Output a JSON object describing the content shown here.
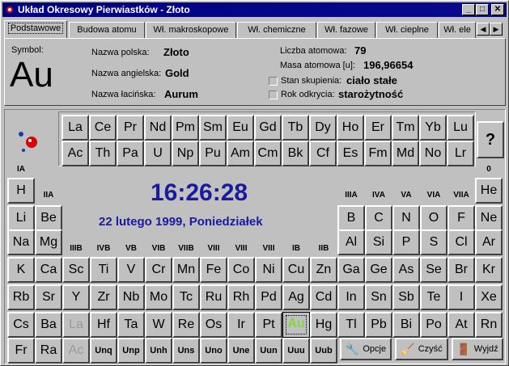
{
  "window": {
    "title": "Układ Okresowy Pierwiastków - Złoto",
    "controls": [
      "minimize",
      "maximize",
      "close"
    ]
  },
  "tabs": [
    {
      "label": "Podstawowe",
      "active": true
    },
    {
      "label": "Budowa atomu"
    },
    {
      "label": "Wł. makroskopowe"
    },
    {
      "label": "Wł. chemiczne"
    },
    {
      "label": "Wł. fazowe"
    },
    {
      "label": "Wł. cieplne"
    },
    {
      "label": "Wł. ele"
    }
  ],
  "info": {
    "symbol_label": "Symbol:",
    "symbol": "Au",
    "polish_label": "Nazwa polska:",
    "polish": "Złoto",
    "english_label": "Nazwa angielska:",
    "english": "Gold",
    "latin_label": "Nazwa łacińska:",
    "latin": "Aurum",
    "atomic_number_label": "Liczba atomowa:",
    "atomic_number": "79",
    "atomic_mass_label": "Masa atomowa [u]:",
    "atomic_mass": "196,96654",
    "state_label": "Stan skupienia:",
    "state": "ciało stałe",
    "discovery_label": "Rok odkrycia:",
    "discovery": "starożytność"
  },
  "clock": {
    "time": "16:26:28",
    "date": "22 lutego 1999, Poniedziałek"
  },
  "help_label": "?",
  "buttons": {
    "options": "Opcje",
    "clear": "Czyść",
    "exit": "Wyjdź"
  },
  "groups": {
    "IA": "IA",
    "IIA": "IIA",
    "IIIB": "IIIB",
    "IVB": "IVB",
    "VB": "VB",
    "VIB": "VIB",
    "VIIB": "VIIB",
    "VIII1": "VIII",
    "VIII2": "VIII",
    "VIII3": "VIII",
    "IB": "IB",
    "IIB": "IIB",
    "IIIA": "IIIA",
    "IVA": "IVA",
    "VA": "VA",
    "VIA": "VIA",
    "VIIA": "VIIA",
    "zero": "0"
  },
  "lanthanides": [
    "La",
    "Ce",
    "Pr",
    "Nd",
    "Pm",
    "Sm",
    "Eu",
    "Gd",
    "Tb",
    "Dy",
    "Ho",
    "Er",
    "Tm",
    "Yb",
    "Lu"
  ],
  "actinides": [
    "Ac",
    "Th",
    "Pa",
    "U",
    "Np",
    "Pu",
    "Am",
    "Cm",
    "Bk",
    "Cf",
    "Es",
    "Fm",
    "Md",
    "No",
    "Lr"
  ],
  "elements": [
    {
      "s": "H",
      "r": 0,
      "c": 0
    },
    {
      "s": "He",
      "r": 0,
      "c": 17
    },
    {
      "s": "Li",
      "r": 1,
      "c": 0
    },
    {
      "s": "Be",
      "r": 1,
      "c": 1
    },
    {
      "s": "B",
      "r": 1,
      "c": 12
    },
    {
      "s": "C",
      "r": 1,
      "c": 13
    },
    {
      "s": "N",
      "r": 1,
      "c": 14
    },
    {
      "s": "O",
      "r": 1,
      "c": 15
    },
    {
      "s": "F",
      "r": 1,
      "c": 16
    },
    {
      "s": "Ne",
      "r": 1,
      "c": 17
    },
    {
      "s": "Na",
      "r": 2,
      "c": 0
    },
    {
      "s": "Mg",
      "r": 2,
      "c": 1
    },
    {
      "s": "Al",
      "r": 2,
      "c": 12
    },
    {
      "s": "Si",
      "r": 2,
      "c": 13
    },
    {
      "s": "P",
      "r": 2,
      "c": 14
    },
    {
      "s": "S",
      "r": 2,
      "c": 15
    },
    {
      "s": "Cl",
      "r": 2,
      "c": 16
    },
    {
      "s": "Ar",
      "r": 2,
      "c": 17
    },
    {
      "s": "K",
      "r": 3,
      "c": 0
    },
    {
      "s": "Ca",
      "r": 3,
      "c": 1
    },
    {
      "s": "Sc",
      "r": 3,
      "c": 2
    },
    {
      "s": "Ti",
      "r": 3,
      "c": 3
    },
    {
      "s": "V",
      "r": 3,
      "c": 4
    },
    {
      "s": "Cr",
      "r": 3,
      "c": 5
    },
    {
      "s": "Mn",
      "r": 3,
      "c": 6
    },
    {
      "s": "Fe",
      "r": 3,
      "c": 7
    },
    {
      "s": "Co",
      "r": 3,
      "c": 8
    },
    {
      "s": "Ni",
      "r": 3,
      "c": 9
    },
    {
      "s": "Cu",
      "r": 3,
      "c": 10
    },
    {
      "s": "Zn",
      "r": 3,
      "c": 11
    },
    {
      "s": "Ga",
      "r": 3,
      "c": 12
    },
    {
      "s": "Ge",
      "r": 3,
      "c": 13
    },
    {
      "s": "As",
      "r": 3,
      "c": 14
    },
    {
      "s": "Se",
      "r": 3,
      "c": 15
    },
    {
      "s": "Br",
      "r": 3,
      "c": 16
    },
    {
      "s": "Kr",
      "r": 3,
      "c": 17
    },
    {
      "s": "Rb",
      "r": 4,
      "c": 0
    },
    {
      "s": "Sr",
      "r": 4,
      "c": 1
    },
    {
      "s": "Y",
      "r": 4,
      "c": 2
    },
    {
      "s": "Zr",
      "r": 4,
      "c": 3
    },
    {
      "s": "Nb",
      "r": 4,
      "c": 4
    },
    {
      "s": "Mo",
      "r": 4,
      "c": 5
    },
    {
      "s": "Tc",
      "r": 4,
      "c": 6
    },
    {
      "s": "Ru",
      "r": 4,
      "c": 7
    },
    {
      "s": "Rh",
      "r": 4,
      "c": 8
    },
    {
      "s": "Pd",
      "r": 4,
      "c": 9
    },
    {
      "s": "Ag",
      "r": 4,
      "c": 10
    },
    {
      "s": "Cd",
      "r": 4,
      "c": 11
    },
    {
      "s": "In",
      "r": 4,
      "c": 12
    },
    {
      "s": "Sn",
      "r": 4,
      "c": 13
    },
    {
      "s": "Sb",
      "r": 4,
      "c": 14
    },
    {
      "s": "Te",
      "r": 4,
      "c": 15
    },
    {
      "s": "I",
      "r": 4,
      "c": 16
    },
    {
      "s": "Xe",
      "r": 4,
      "c": 17
    },
    {
      "s": "Cs",
      "r": 5,
      "c": 0
    },
    {
      "s": "Ba",
      "r": 5,
      "c": 1
    },
    {
      "s": "La",
      "r": 5,
      "c": 2,
      "dim": true
    },
    {
      "s": "Hf",
      "r": 5,
      "c": 3
    },
    {
      "s": "Ta",
      "r": 5,
      "c": 4
    },
    {
      "s": "W",
      "r": 5,
      "c": 5
    },
    {
      "s": "Re",
      "r": 5,
      "c": 6
    },
    {
      "s": "Os",
      "r": 5,
      "c": 7
    },
    {
      "s": "Ir",
      "r": 5,
      "c": 8
    },
    {
      "s": "Pt",
      "r": 5,
      "c": 9
    },
    {
      "s": "Au",
      "r": 5,
      "c": 10,
      "sel": true
    },
    {
      "s": "Hg",
      "r": 5,
      "c": 11
    },
    {
      "s": "Tl",
      "r": 5,
      "c": 12
    },
    {
      "s": "Pb",
      "r": 5,
      "c": 13
    },
    {
      "s": "Bi",
      "r": 5,
      "c": 14
    },
    {
      "s": "Po",
      "r": 5,
      "c": 15
    },
    {
      "s": "At",
      "r": 5,
      "c": 16
    },
    {
      "s": "Rn",
      "r": 5,
      "c": 17
    },
    {
      "s": "Fr",
      "r": 6,
      "c": 0
    },
    {
      "s": "Ra",
      "r": 6,
      "c": 1
    },
    {
      "s": "Ac",
      "r": 6,
      "c": 2,
      "dim": true
    },
    {
      "s": "Unq",
      "r": 6,
      "c": 3,
      "small": true
    },
    {
      "s": "Unp",
      "r": 6,
      "c": 4,
      "small": true
    },
    {
      "s": "Unh",
      "r": 6,
      "c": 5,
      "small": true
    },
    {
      "s": "Uns",
      "r": 6,
      "c": 6,
      "small": true
    },
    {
      "s": "Uno",
      "r": 6,
      "c": 7,
      "small": true
    },
    {
      "s": "Une",
      "r": 6,
      "c": 8,
      "small": true
    },
    {
      "s": "Uun",
      "r": 6,
      "c": 9,
      "small": true
    },
    {
      "s": "Uuu",
      "r": 6,
      "c": 10,
      "small": true
    },
    {
      "s": "Uub",
      "r": 6,
      "c": 11,
      "small": true
    }
  ]
}
